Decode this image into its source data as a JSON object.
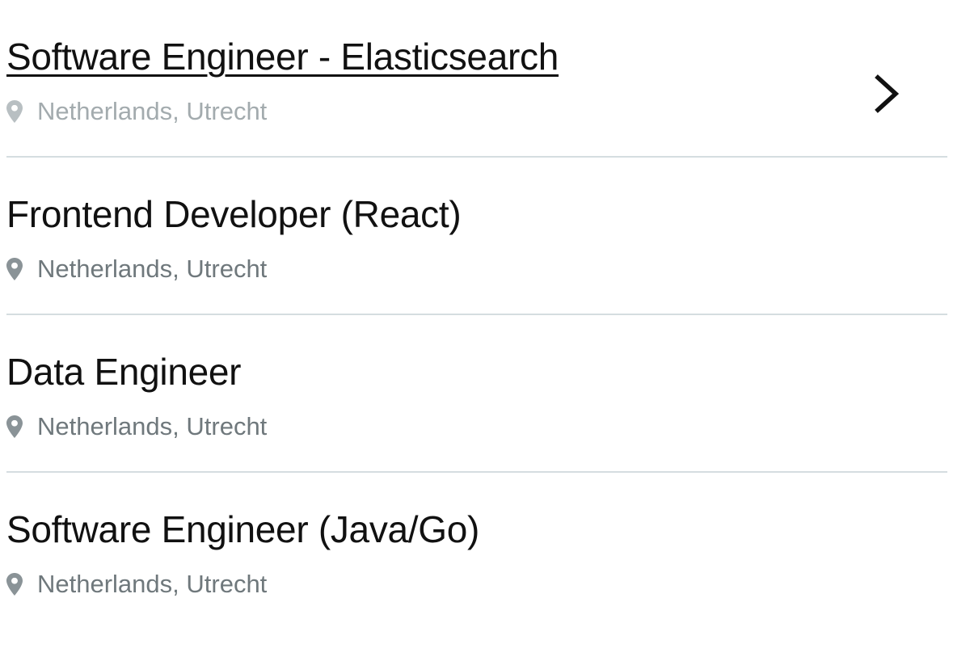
{
  "jobs": [
    {
      "title": "Software Engineer - Elasticsearch",
      "location": "Netherlands, Utrecht",
      "active": true
    },
    {
      "title": "Frontend Developer (React)",
      "location": "Netherlands, Utrecht",
      "active": false
    },
    {
      "title": "Data Engineer",
      "location": "Netherlands, Utrecht",
      "active": false
    },
    {
      "title": "Software Engineer (Java/Go)",
      "location": "Netherlands, Utrecht",
      "active": false
    }
  ],
  "icons": {
    "location": "map-pin-icon",
    "open": "chevron-right-icon"
  },
  "colors": {
    "title": "#111111",
    "location_text": "#6f787c",
    "divider": "#d5dde0"
  }
}
